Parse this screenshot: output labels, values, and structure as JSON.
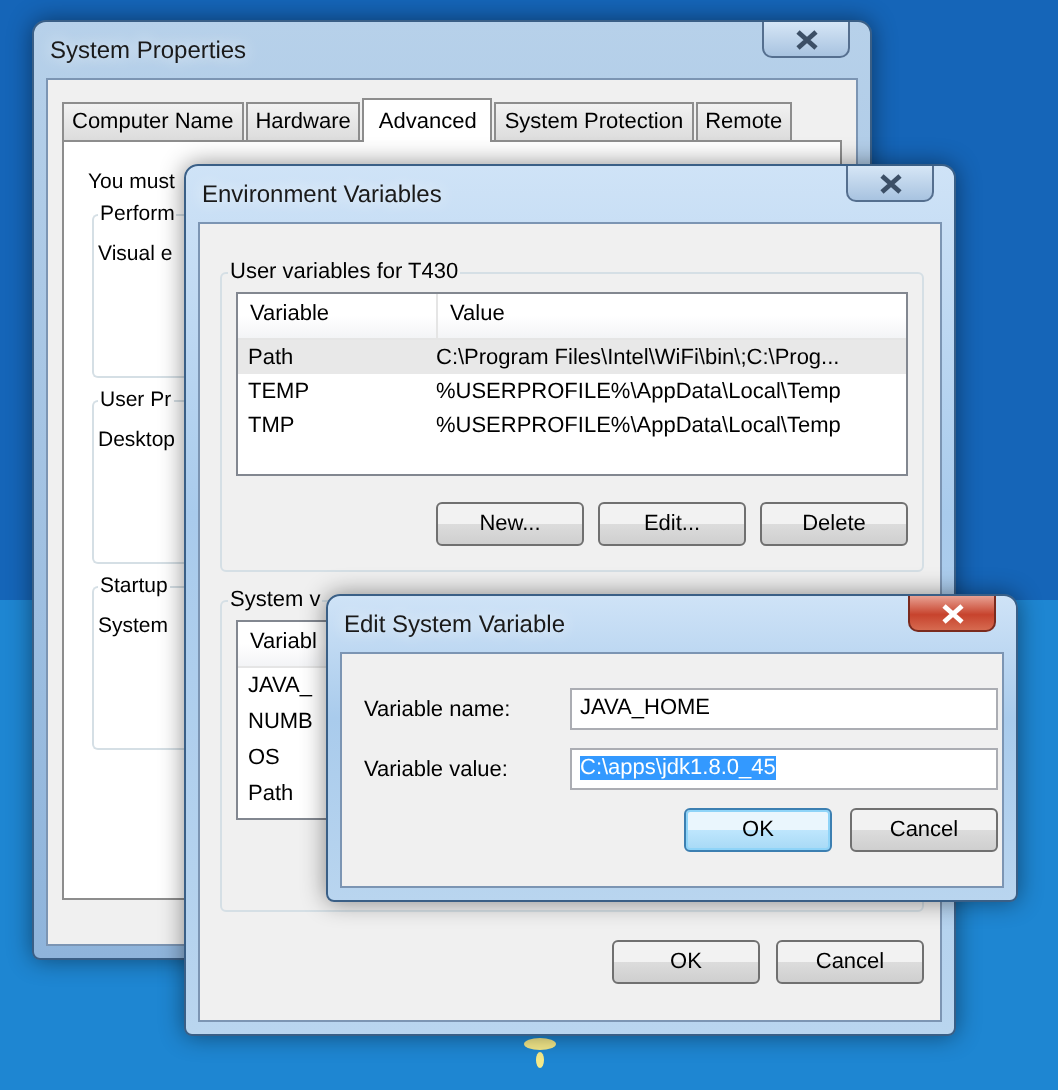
{
  "system_properties": {
    "title": "System Properties",
    "tabs": [
      {
        "label": "Computer Name",
        "selected": false
      },
      {
        "label": "Hardware",
        "selected": false
      },
      {
        "label": "Advanced",
        "selected": true
      },
      {
        "label": "System Protection",
        "selected": false
      },
      {
        "label": "Remote",
        "selected": false
      }
    ],
    "notice": "You must",
    "groups": [
      {
        "label": "Perform",
        "text": "Visual e"
      },
      {
        "label": "User Pr",
        "text": "Desktop"
      },
      {
        "label": "Startup",
        "text": "System"
      }
    ]
  },
  "environment_variables": {
    "title": "Environment Variables",
    "user_group": {
      "label": "User variables for T430",
      "columns": [
        "Variable",
        "Value"
      ],
      "rows": [
        {
          "variable": "Path",
          "value": "C:\\Program Files\\Intel\\WiFi\\bin\\;C:\\Prog...",
          "selected": true
        },
        {
          "variable": "TEMP",
          "value": "%USERPROFILE%\\AppData\\Local\\Temp",
          "selected": false
        },
        {
          "variable": "TMP",
          "value": "%USERPROFILE%\\AppData\\Local\\Temp",
          "selected": false
        }
      ],
      "buttons": [
        "New...",
        "Edit...",
        "Delete"
      ]
    },
    "system_group": {
      "label": "System v",
      "columns": [
        "Variabl"
      ],
      "rows": [
        {
          "variable": "JAVA_",
          "selected": false
        },
        {
          "variable": "NUMB",
          "selected": false
        },
        {
          "variable": "OS",
          "selected": false
        },
        {
          "variable": "Path",
          "selected": false
        }
      ]
    },
    "buttons": [
      "OK",
      "Cancel"
    ]
  },
  "edit_dialog": {
    "title": "Edit System Variable",
    "fields": [
      {
        "label": "Variable name:",
        "value": "JAVA_HOME",
        "selected": false
      },
      {
        "label": "Variable value:",
        "value": "C:\\apps\\jdk1.8.0_45",
        "selected": true
      }
    ],
    "buttons": [
      {
        "label": "OK",
        "default": true
      },
      {
        "label": "Cancel",
        "default": false
      }
    ]
  }
}
